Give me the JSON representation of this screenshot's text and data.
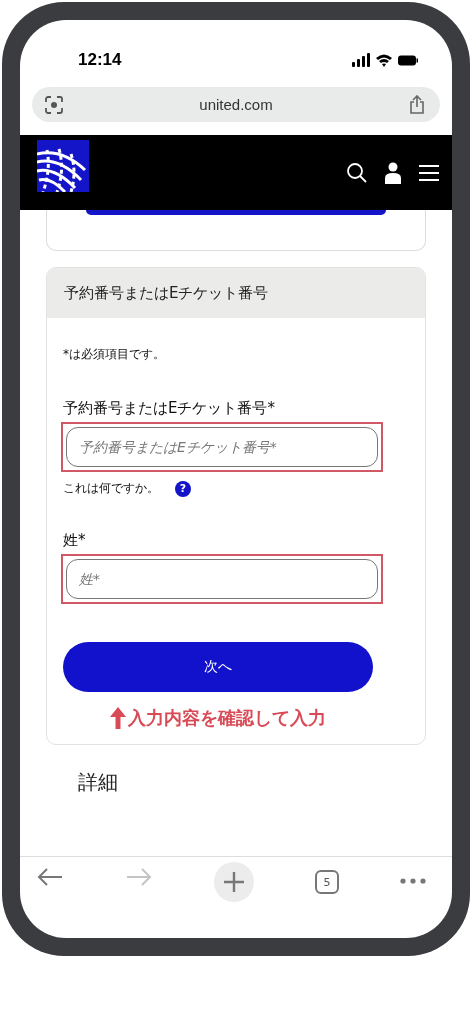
{
  "status_bar": {
    "time": "12:14"
  },
  "address_bar": {
    "url": "united.com"
  },
  "form_card": {
    "title": "予約番号またはEチケット番号",
    "required_note": "*は必須項目です。",
    "fields": [
      {
        "label": "予約番号またはEチケット番号*",
        "placeholder": "予約番号またはEチケット番号*",
        "highlighted": true,
        "help_link": "これは何ですか。",
        "help_icon": "?"
      },
      {
        "label": "姓*",
        "placeholder": "姓*",
        "highlighted": true
      }
    ],
    "submit_button": "次へ",
    "annotation": "入力内容を確認して入力"
  },
  "details_heading": "詳細",
  "toolbar": {
    "items": [
      {
        "kind": "back",
        "disabled": false
      },
      {
        "kind": "forward",
        "disabled": true
      },
      {
        "kind": "new_tab",
        "disabled": false
      },
      {
        "kind": "tabs",
        "count": "5",
        "disabled": false
      },
      {
        "kind": "more",
        "disabled": false
      }
    ]
  }
}
